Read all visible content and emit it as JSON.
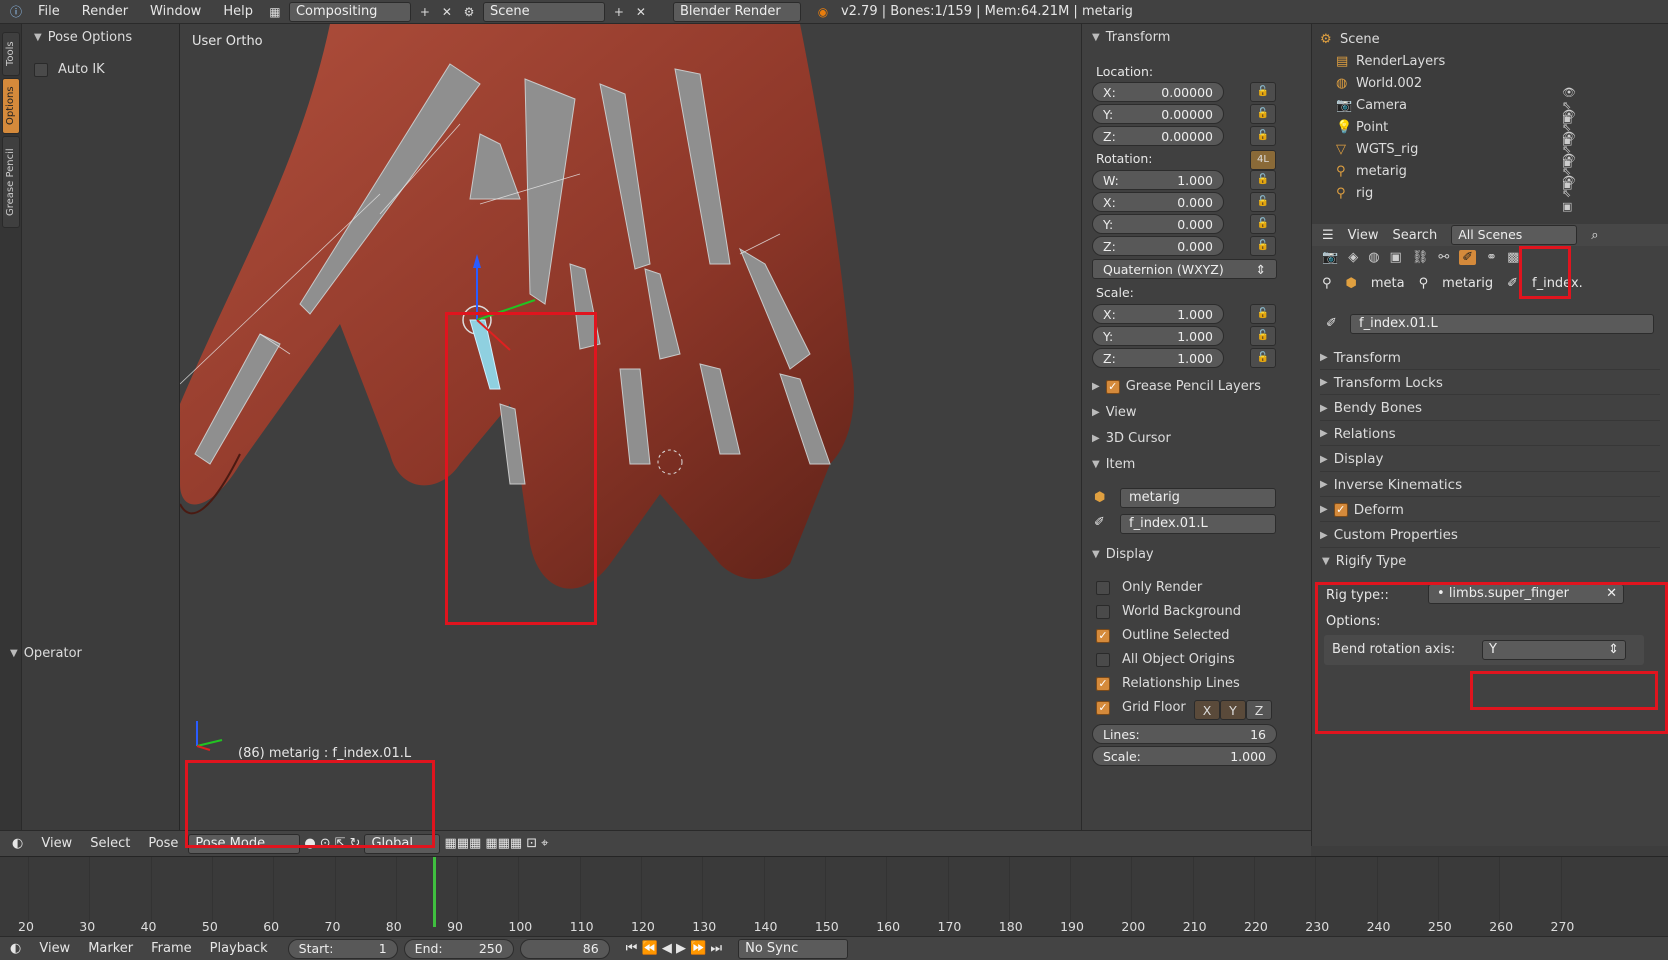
{
  "topbar": {
    "menus": [
      "File",
      "Render",
      "Window",
      "Help"
    ],
    "layout": "Compositing",
    "scene": "Scene",
    "engine": "Blender Render",
    "info": "v2.79 | Bones:1/159 | Mem:64.21M | metarig"
  },
  "left": {
    "tabs": [
      "Tools",
      "Options",
      "Grease Pencil"
    ],
    "pose_options": "Pose Options",
    "auto_ik": "Auto IK",
    "operator": "Operator"
  },
  "viewport": {
    "view_label": "User Ortho",
    "status": "(86) metarig : f_index.01.L"
  },
  "npanel": {
    "transform": "Transform",
    "location_label": "Location:",
    "location": [
      {
        "axis": "X:",
        "value": "0.00000"
      },
      {
        "axis": "Y:",
        "value": "0.00000"
      },
      {
        "axis": "Z:",
        "value": "0.00000"
      }
    ],
    "rotation_label": "Rotation:",
    "rotation_badge": "4L",
    "rotation": [
      {
        "axis": "W:",
        "value": "1.000"
      },
      {
        "axis": "X:",
        "value": "0.000"
      },
      {
        "axis": "Y:",
        "value": "0.000"
      },
      {
        "axis": "Z:",
        "value": "0.000"
      }
    ],
    "rotation_mode": "Quaternion (WXYZ)",
    "scale_label": "Scale:",
    "scale": [
      {
        "axis": "X:",
        "value": "1.000"
      },
      {
        "axis": "Y:",
        "value": "1.000"
      },
      {
        "axis": "Z:",
        "value": "1.000"
      }
    ],
    "grease_pencil_layers": "Grease Pencil Layers",
    "view": "View",
    "cursor": "3D Cursor",
    "item": "Item",
    "item_object": "metarig",
    "item_bone": "f_index.01.L",
    "display": "Display",
    "display_options": [
      {
        "label": "Only Render",
        "checked": false
      },
      {
        "label": "World Background",
        "checked": false
      },
      {
        "label": "Outline Selected",
        "checked": true
      },
      {
        "label": "All Object Origins",
        "checked": false
      },
      {
        "label": "Relationship Lines",
        "checked": true
      },
      {
        "label": "Grid Floor",
        "checked": true
      }
    ],
    "grid_axes": [
      "X",
      "Y",
      "Z"
    ],
    "lines_label": "Lines:",
    "lines_value": "16",
    "scale2_label": "Scale:",
    "scale2_value": "1.000"
  },
  "outliner": {
    "items": [
      "Scene",
      "RenderLayers",
      "World.002",
      "Camera",
      "Point",
      "WGTS_rig",
      "metarig",
      "rig"
    ],
    "header_tabs": [
      "View",
      "Search"
    ],
    "scope": "All Scenes"
  },
  "props": {
    "crumbs": [
      "meta",
      "metarig",
      "f_index."
    ],
    "bone_name": "f_index.01.L",
    "panels": [
      "Transform",
      "Transform Locks",
      "Bendy Bones",
      "Relations",
      "Display",
      "Inverse Kinematics",
      "Deform",
      "Custom Properties"
    ],
    "rigify": {
      "title": "Rigify Type",
      "rig_type_label": "Rig type::",
      "rig_type_value": "limbs.super_finger",
      "options_label": "Options:",
      "bend_label": "Bend rotation axis:",
      "bend_value": "Y"
    }
  },
  "vpbar": {
    "menus": [
      "View",
      "Select",
      "Pose"
    ],
    "mode": "Pose Mode",
    "orientation": "Global"
  },
  "timeline": {
    "ticks": [
      "20",
      "30",
      "40",
      "50",
      "60",
      "70",
      "80",
      "90",
      "100",
      "110",
      "120",
      "130",
      "140",
      "150",
      "160",
      "170",
      "180",
      "190",
      "200",
      "210",
      "220",
      "230",
      "240",
      "250",
      "260",
      "270"
    ],
    "current_frame": 86,
    "menus": [
      "View",
      "Marker",
      "Frame",
      "Playback"
    ],
    "start_label": "Start:",
    "start_value": "1",
    "end_label": "End:",
    "end_value": "250",
    "frame_value": "86",
    "sync": "No Sync"
  },
  "colors": {
    "accent": "#d58a3b",
    "highlight": "#e0141e",
    "skin": "#8e3a2c",
    "bg": "#3f3f3f"
  }
}
